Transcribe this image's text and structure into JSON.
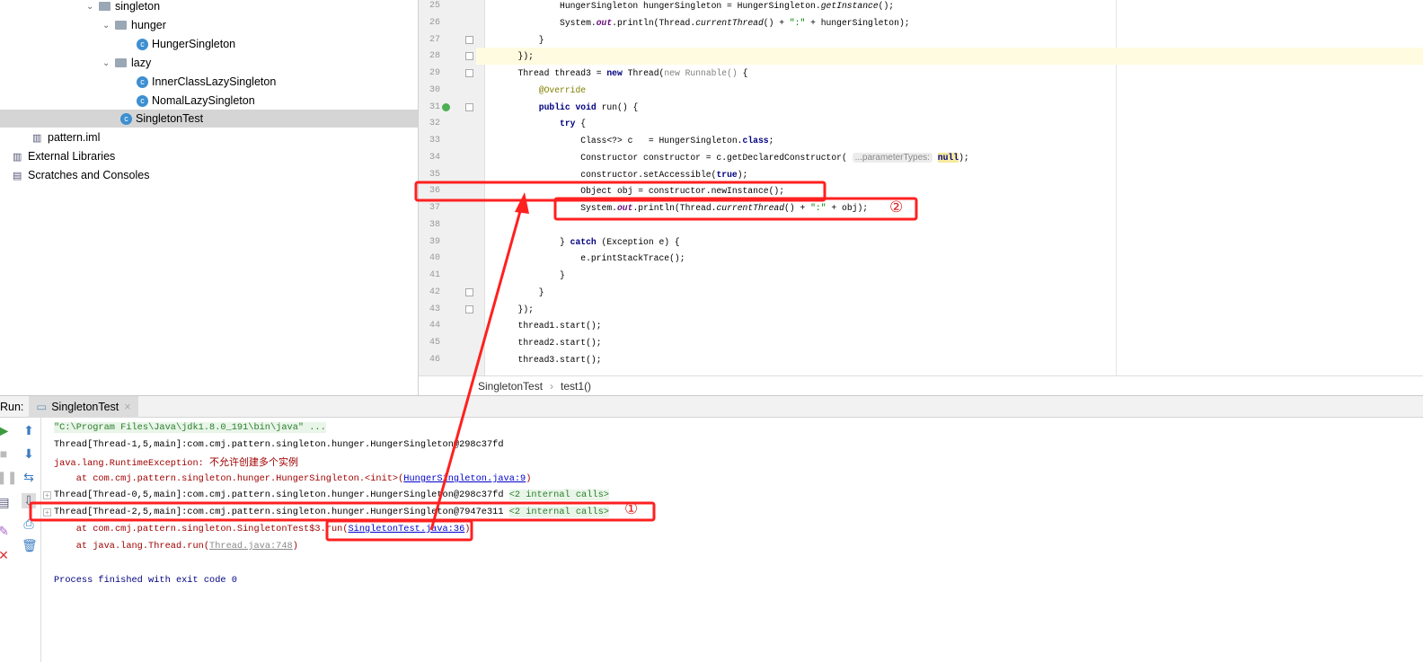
{
  "project_tree": {
    "items": [
      {
        "label": "singleton",
        "type": "folder",
        "expanded": true
      },
      {
        "label": "hunger",
        "type": "folder",
        "expanded": true
      },
      {
        "label": "HungerSingleton",
        "type": "class"
      },
      {
        "label": "lazy",
        "type": "folder",
        "expanded": true
      },
      {
        "label": "InnerClassLazySingleton",
        "type": "class"
      },
      {
        "label": "NomalLazySingleton",
        "type": "class"
      },
      {
        "label": "SingletonTest",
        "type": "class",
        "selected": true
      },
      {
        "label": "pattern.iml",
        "type": "file"
      },
      {
        "label": "External Libraries",
        "type": "library"
      },
      {
        "label": "Scratches and Consoles",
        "type": "scratch"
      }
    ]
  },
  "editor": {
    "line_numbers": [
      "25",
      "26",
      "27",
      "28",
      "29",
      "30",
      "31",
      "32",
      "33",
      "34",
      "35",
      "36",
      "37",
      "38",
      "39",
      "40",
      "41",
      "42",
      "43",
      "44",
      "45",
      "46"
    ],
    "hint_label": "...parameterTypes:",
    "breadcrumb": [
      "SingletonTest",
      "test1()"
    ]
  },
  "run": {
    "label": "Run:",
    "tab": "SingletonTest",
    "console": {
      "cmd": "\"C:\\Program Files\\Java\\jdk1.8.0_191\\bin\\java\" ...",
      "l1": "Thread[Thread-1,5,main]:com.cmj.pattern.singleton.hunger.HungerSingleton@298c37fd",
      "l2a": "java.lang.RuntimeException: ",
      "l2b": "不允许创建多个实例",
      "l3a": "    at com.cmj.pattern.singleton.hunger.HungerSingleton.<init>(",
      "l3b": "HungerSingleton.java:9",
      "l3c": ")",
      "l4a": "Thread[Thread-0,5,main]:com.cmj.pattern.singleton.hunger.HungerSingleton@298c37fd ",
      "l4b": "<2 internal calls>",
      "l5a": "Thread[Thread-2,5,main]:com.cmj.pattern.singleton.hunger.HungerSingleton@7947e311 ",
      "l5b": "<2 internal calls>",
      "l6a": "    at com.cmj.pattern.singleton.SingletonTest$3.run(",
      "l6b": "SingletonTest.java:36",
      "l6c": ")",
      "l7a": "    at java.lang.Thread.run(",
      "l7b": "Thread.java:748",
      "l7c": ")",
      "l8": "Process finished with exit code 0"
    }
  },
  "annotations": {
    "marker1": "①",
    "marker2": "②",
    "color": "#ff2020"
  }
}
